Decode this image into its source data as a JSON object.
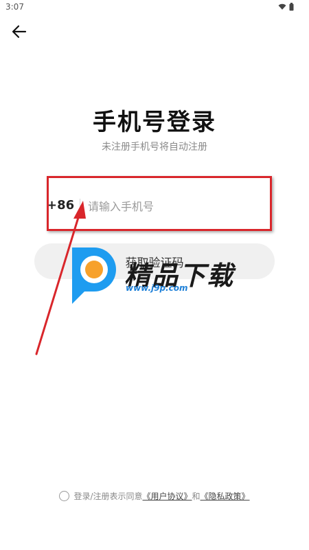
{
  "status_bar": {
    "time": "3:07"
  },
  "login": {
    "title": "手机号登录",
    "subtitle": "未注册手机号将自动注册",
    "country_code": "+86",
    "phone_placeholder": "请输入手机号",
    "phone_value": "",
    "get_code_label": "获取验证码"
  },
  "agreement": {
    "prefix": "登录/注册表示同意",
    "user_agreement": "《用户协议》",
    "and": "和",
    "privacy_policy": "《隐私政策》"
  },
  "watermark": {
    "brand": "精品下载",
    "url": "www.j9p.com"
  },
  "colors": {
    "annotation_red": "#d9262b",
    "watermark_blue": "#1e9cf0",
    "watermark_orange": "#f7a12b"
  }
}
